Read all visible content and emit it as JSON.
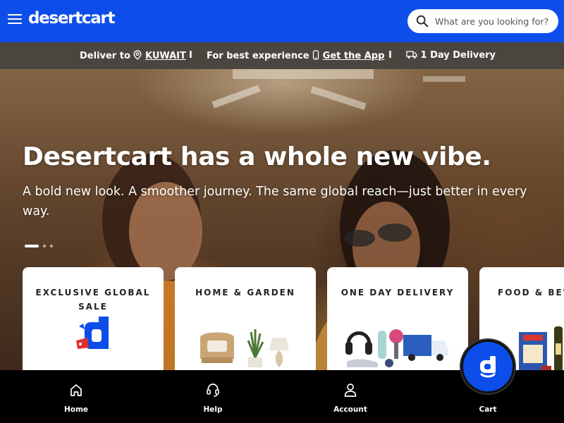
{
  "header": {
    "brand": "desertcart",
    "search_placeholder": "What are you looking for?"
  },
  "infobar": {
    "deliver_prefix": "Deliver to",
    "country": "KUWAIT",
    "separator": "I",
    "experience_text": "For best experience",
    "app_link": "Get the App",
    "delivery_text": "1 Day Delivery"
  },
  "hero": {
    "title": "Desertcart has a whole new vibe.",
    "subtitle": "A bold new look. A smoother journey. The same global reach—just better in every way.",
    "slide_count": 3,
    "active_slide": 1
  },
  "categories": [
    {
      "title": "EXCLUSIVE GLOBAL SALE"
    },
    {
      "title": "HOME & GARDEN"
    },
    {
      "title": "ONE DAY DELIVERY"
    },
    {
      "title": "FOOD & BEVE"
    }
  ],
  "bottom_nav": {
    "items": [
      {
        "label": "Home",
        "icon": "home-icon"
      },
      {
        "label": "Help",
        "icon": "headset-icon"
      },
      {
        "label": "Account",
        "icon": "user-icon"
      },
      {
        "label": "Cart",
        "icon": "cart-icon"
      }
    ]
  },
  "colors": {
    "brand_blue": "#0d4eea",
    "infobar_bg": "#4b4540",
    "nav_bg": "#000000"
  }
}
